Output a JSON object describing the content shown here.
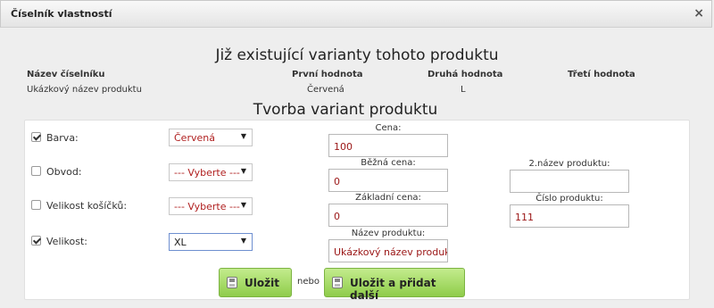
{
  "window": {
    "title": "Číselník vlastností",
    "close_glyph": "×"
  },
  "existing": {
    "heading": "Již existující varianty tohoto produktu",
    "headers": [
      "Název číselníku",
      "První hodnota",
      "Druhá hodnota",
      "Třetí hodnota"
    ],
    "row": [
      "Ukázkový název produktu",
      "Červená",
      "L",
      ""
    ]
  },
  "create": {
    "heading": "Tvorba variant produktu",
    "properties": [
      {
        "label": "Barva:",
        "checked": true,
        "value": "Červená"
      },
      {
        "label": "Obvod:",
        "checked": false,
        "value": "--- Vyberte ---"
      },
      {
        "label": "Velikost košíčků:",
        "checked": false,
        "value": "--- Vyberte ---"
      },
      {
        "label": "Velikost:",
        "checked": true,
        "value": "XL"
      }
    ],
    "fields": {
      "cena": {
        "label": "Cena:",
        "value": "100"
      },
      "bezna_cena": {
        "label": "Běžná cena:",
        "value": "0"
      },
      "zakladni_cena": {
        "label": "Základní cena:",
        "value": "0"
      },
      "nazev_produktu": {
        "label": "Název produktu:",
        "value": "Ukázkový název produktu"
      },
      "nazev2": {
        "label": "2.název produktu:",
        "value": ""
      },
      "cislo_produktu": {
        "label": "Číslo produktu:",
        "value": "111"
      }
    },
    "save_label": "Uložit",
    "or_label": "nebo",
    "save_add_label": "Uložit a přidat další"
  },
  "colors": {
    "button_green": "#8fcc4a",
    "value_red": "#9a1515"
  }
}
